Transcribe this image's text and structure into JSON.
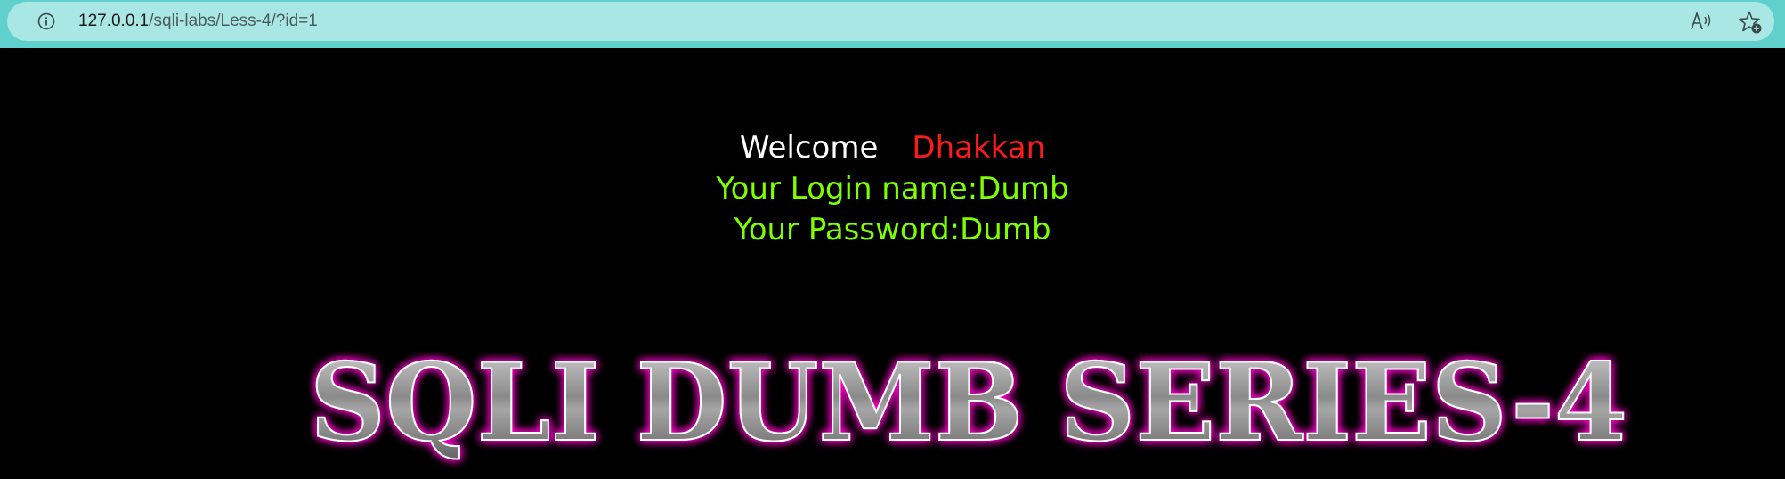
{
  "browser": {
    "url_host": "127.0.0.1",
    "url_path": "/sqli-labs/Less-4/?id=1",
    "icons": [
      "info-icon",
      "read-aloud-icon",
      "favorite-add-icon"
    ]
  },
  "page": {
    "welcome_label": "Welcome",
    "welcome_name": "Dhakkan",
    "login_line": "Your Login name:Dumb",
    "password_line": "Your Password:Dumb",
    "banner_text": "SQLI DUMB SERIES-4",
    "colors": {
      "background": "#000000",
      "welcome": "#ffffff",
      "name": "#ff1a1a",
      "credentials": "#7cff00",
      "banner_glow": "#ff00cc",
      "banner_fill": "#9a9a9a"
    }
  }
}
